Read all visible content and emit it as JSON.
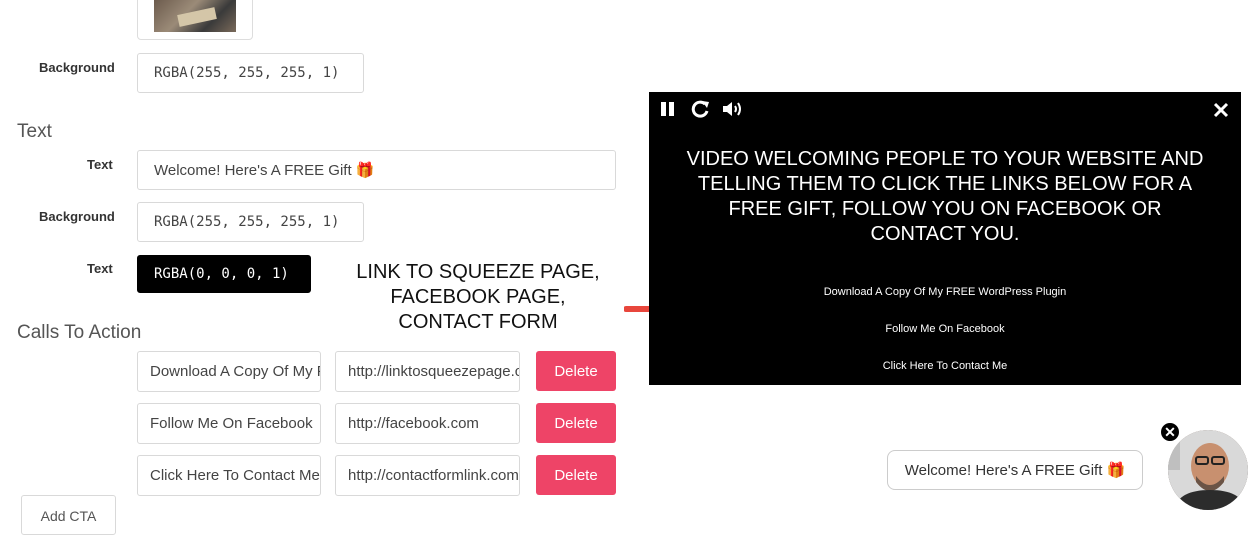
{
  "image_section": {
    "thumbnail_alt": ""
  },
  "image_background": {
    "label": "Background",
    "value": "RGBA(255, 255, 255, 1)"
  },
  "text_section": {
    "heading": "Text",
    "text_label": "Text",
    "text_value": "Welcome! Here's A FREE Gift 🎁",
    "background_label": "Background",
    "background_value": "RGBA(255, 255, 255, 1)",
    "color_label": "Text",
    "color_value": "RGBA(0, 0, 0, 1)"
  },
  "cta_section": {
    "heading": "Calls To Action",
    "rows": [
      {
        "label": "Download A Copy Of My FREE WordPress Plugin",
        "url": "http://linktosqueezepage.com",
        "delete": "Delete"
      },
      {
        "label": "Follow Me On Facebook",
        "url": "http://facebook.com",
        "delete": "Delete"
      },
      {
        "label": "Click Here To Contact Me",
        "url": "http://contactformlink.com",
        "delete": "Delete"
      }
    ],
    "add_label": "Add CTA"
  },
  "annotation": {
    "text": "LINK TO SQUEEZE PAGE, FACEBOOK PAGE, CONTACT FORM",
    "arrow_color": "#e8463c"
  },
  "video": {
    "title": "VIDEO WELCOMING PEOPLE TO YOUR WEBSITE AND TELLING THEM TO CLICK THE LINKS BELOW FOR A FREE GIFT, FOLLOW YOU ON FACEBOOK OR CONTACT YOU.",
    "links": [
      "Download A Copy Of My FREE WordPress Plugin",
      "Follow Me On Facebook",
      "Click Here To Contact Me"
    ],
    "icons": [
      "pause-icon",
      "replay-icon",
      "volume-icon",
      "close-icon"
    ]
  },
  "widget": {
    "bubble_text": "Welcome! Here's A FREE Gift 🎁"
  },
  "colors": {
    "delete_button": "#ee4467",
    "video_bg": "#000000",
    "dark_field": "#000000"
  }
}
